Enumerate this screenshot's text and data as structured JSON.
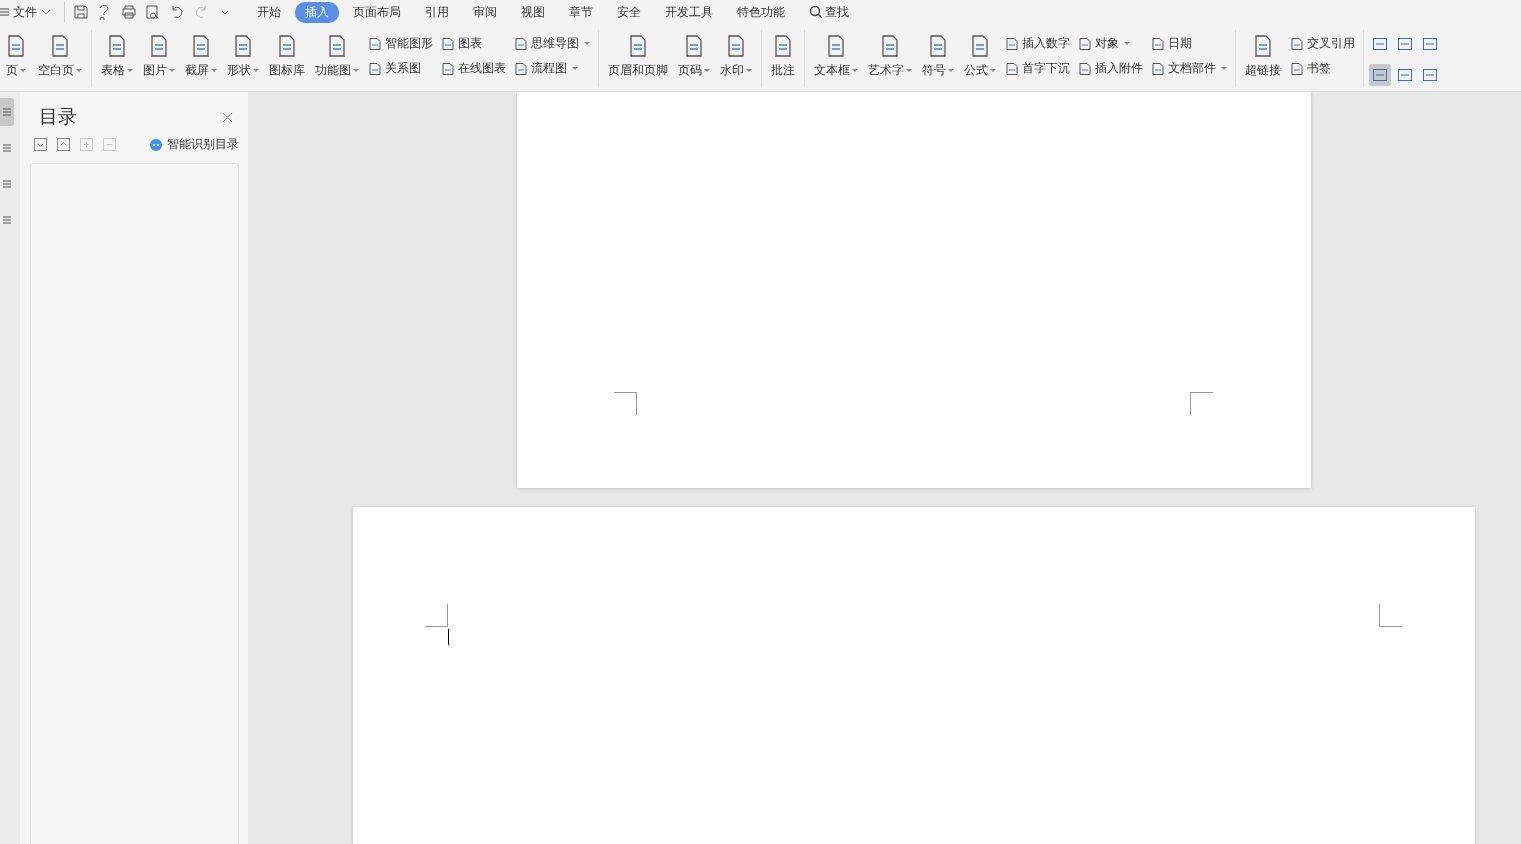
{
  "title_bar": {
    "file_menu": "文件",
    "tabs": [
      {
        "label": "开始",
        "selected": false
      },
      {
        "label": "插入",
        "selected": true
      },
      {
        "label": "页面布局",
        "selected": false
      },
      {
        "label": "引用",
        "selected": false
      },
      {
        "label": "审阅",
        "selected": false
      },
      {
        "label": "视图",
        "selected": false
      },
      {
        "label": "章节",
        "selected": false
      },
      {
        "label": "安全",
        "selected": false
      },
      {
        "label": "开发工具",
        "selected": false
      },
      {
        "label": "特色功能",
        "selected": false
      }
    ],
    "search": "查找"
  },
  "ribbon": {
    "groups": [
      {
        "columns": [
          {
            "kind": "large",
            "items": [
              {
                "label": "页",
                "dropdown": true
              }
            ]
          },
          {
            "kind": "large",
            "items": [
              {
                "label": "空白页",
                "dropdown": true
              }
            ]
          }
        ]
      },
      {
        "columns": [
          {
            "kind": "large",
            "items": [
              {
                "label": "表格",
                "dropdown": true
              }
            ]
          },
          {
            "kind": "large",
            "items": [
              {
                "label": "图片",
                "dropdown": true
              }
            ]
          },
          {
            "kind": "large",
            "items": [
              {
                "label": "截屏",
                "dropdown": true
              }
            ]
          },
          {
            "kind": "large",
            "items": [
              {
                "label": "形状",
                "dropdown": true
              }
            ]
          },
          {
            "kind": "large",
            "items": [
              {
                "label": "图标库",
                "dropdown": false
              }
            ]
          },
          {
            "kind": "large",
            "items": [
              {
                "label": "功能图",
                "dropdown": true
              }
            ]
          },
          {
            "kind": "stack",
            "items": [
              {
                "label": "智能图形",
                "dropdown": false
              },
              {
                "label": "关系图",
                "dropdown": false
              }
            ]
          },
          {
            "kind": "stack",
            "items": [
              {
                "label": "图表",
                "dropdown": false
              },
              {
                "label": "在线图表",
                "dropdown": false
              }
            ]
          },
          {
            "kind": "stack",
            "items": [
              {
                "label": "思维导图",
                "dropdown": true
              },
              {
                "label": "流程图",
                "dropdown": true
              }
            ]
          }
        ]
      },
      {
        "columns": [
          {
            "kind": "large",
            "items": [
              {
                "label": "页眉和页脚",
                "dropdown": false
              }
            ]
          },
          {
            "kind": "large",
            "items": [
              {
                "label": "页码",
                "dropdown": true
              }
            ]
          },
          {
            "kind": "large",
            "items": [
              {
                "label": "水印",
                "dropdown": true
              }
            ]
          }
        ]
      },
      {
        "columns": [
          {
            "kind": "large",
            "items": [
              {
                "label": "批注",
                "dropdown": false
              }
            ]
          }
        ]
      },
      {
        "columns": [
          {
            "kind": "large",
            "items": [
              {
                "label": "文本框",
                "dropdown": true
              }
            ]
          },
          {
            "kind": "large",
            "items": [
              {
                "label": "艺术字",
                "dropdown": true
              }
            ]
          },
          {
            "kind": "large",
            "items": [
              {
                "label": "符号",
                "dropdown": true
              }
            ]
          },
          {
            "kind": "large",
            "items": [
              {
                "label": "公式",
                "dropdown": true
              }
            ]
          },
          {
            "kind": "stack",
            "items": [
              {
                "label": "插入数字",
                "dropdown": false
              },
              {
                "label": "首字下沉",
                "dropdown": false
              }
            ]
          },
          {
            "kind": "stack",
            "items": [
              {
                "label": "对象",
                "dropdown": true
              },
              {
                "label": "插入附件",
                "dropdown": false
              }
            ]
          },
          {
            "kind": "stack",
            "items": [
              {
                "label": "日期",
                "dropdown": false
              },
              {
                "label": "文档部件",
                "dropdown": true
              }
            ]
          }
        ]
      },
      {
        "columns": [
          {
            "kind": "large",
            "items": [
              {
                "label": "超链接",
                "dropdown": false
              }
            ]
          },
          {
            "kind": "stack",
            "items": [
              {
                "label": "交叉引用",
                "dropdown": false
              },
              {
                "label": "书签",
                "dropdown": false
              }
            ]
          }
        ]
      }
    ],
    "icon_buttons": [
      {
        "selected": false
      },
      {
        "selected": false
      },
      {
        "selected": false
      },
      {
        "selected": true
      },
      {
        "selected": false
      },
      {
        "selected": false
      }
    ]
  },
  "side_strip": [
    {
      "selected": true
    },
    {
      "selected": false
    },
    {
      "selected": false
    },
    {
      "selected": false
    }
  ],
  "toc_panel": {
    "title": "目录",
    "tools": [
      {
        "disabled": false
      },
      {
        "disabled": false
      },
      {
        "disabled": true
      },
      {
        "disabled": true
      }
    ],
    "smart_button": "智能识别目录"
  }
}
